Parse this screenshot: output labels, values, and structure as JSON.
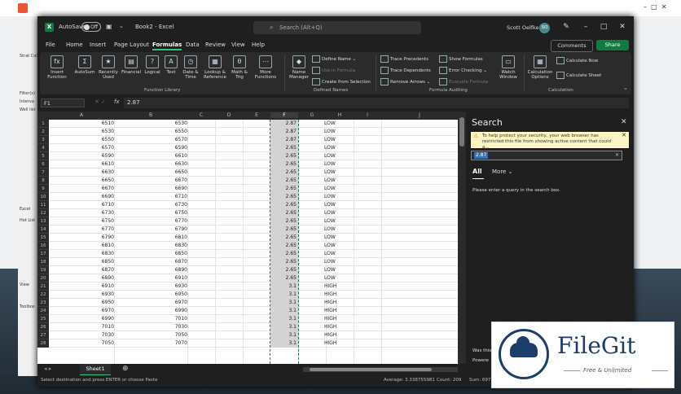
{
  "bg_app": {
    "title": "Strat Coll Manag",
    "side_labels": [
      "Filter(s)",
      "Interva",
      "Well list",
      "Excel",
      "Hot List",
      "View",
      "Toolbox"
    ]
  },
  "excel": {
    "autosave_label": "AutoSave",
    "autosave_state": "Off",
    "doc_name": "Book2 - Excel",
    "search_placeholder": "Search (Alt+Q)",
    "user_name": "Scott Oelfke",
    "user_initials": "SO",
    "tabs": [
      "File",
      "Home",
      "Insert",
      "Page Layout",
      "Formulas",
      "Data",
      "Review",
      "View",
      "Help"
    ],
    "active_tab": "Formulas",
    "comments_label": "Comments",
    "share_label": "Share",
    "ribbon": {
      "insert_function": "Insert Function",
      "autosum": "AutoSum",
      "recently_used": "Recently Used",
      "financial": "Financial",
      "logical": "Logical",
      "text": "Text",
      "date_time": "Date & Time",
      "lookup_reference": "Lookup & Reference",
      "math_trig": "Math & Trig",
      "more_functions": "More Functions",
      "group_function_library": "Function Library",
      "name_manager": "Name Manager",
      "define_name": "Define Name",
      "use_in_formula": "Use in Formula",
      "create_from_selection": "Create from Selection",
      "group_defined_names": "Defined Names",
      "trace_precedents": "Trace Precedents",
      "trace_dependents": "Trace Dependents",
      "remove_arrows": "Remove Arrows",
      "show_formulas": "Show Formulas",
      "error_checking": "Error Checking",
      "evaluate_formula": "Evaluate Formula",
      "watch_window": "Watch Window",
      "group_formula_auditing": "Formula Auditing",
      "calculation_options": "Calculation Options",
      "calculate_now": "Calculate Now",
      "calculate_sheet": "Calculate Sheet",
      "group_calculation": "Calculation"
    },
    "name_box": "F1",
    "formula_value": "2.87",
    "columns": [
      "A",
      "B",
      "C",
      "D",
      "E",
      "F",
      "G",
      "H",
      "I",
      "J"
    ],
    "rows": [
      {
        "n": "1",
        "a": "6510",
        "b": "6530",
        "f": "2.87",
        "g": "LOW"
      },
      {
        "n": "2",
        "a": "6530",
        "b": "6550",
        "f": "2.87",
        "g": "LOW"
      },
      {
        "n": "3",
        "a": "6550",
        "b": "6570",
        "f": "2.87",
        "g": "LOW"
      },
      {
        "n": "4",
        "a": "6570",
        "b": "6590",
        "f": "2.65",
        "g": "LOW"
      },
      {
        "n": "5",
        "a": "6590",
        "b": "6610",
        "f": "2.65",
        "g": "LOW"
      },
      {
        "n": "6",
        "a": "6610",
        "b": "6630",
        "f": "2.65",
        "g": "LOW"
      },
      {
        "n": "7",
        "a": "6630",
        "b": "6650",
        "f": "2.65",
        "g": "LOW"
      },
      {
        "n": "8",
        "a": "6650",
        "b": "6670",
        "f": "2.65",
        "g": "LOW"
      },
      {
        "n": "9",
        "a": "6670",
        "b": "6690",
        "f": "2.65",
        "g": "LOW"
      },
      {
        "n": "10",
        "a": "6690",
        "b": "6710",
        "f": "2.65",
        "g": "LOW"
      },
      {
        "n": "11",
        "a": "6710",
        "b": "6730",
        "f": "2.65",
        "g": "LOW"
      },
      {
        "n": "12",
        "a": "6730",
        "b": "6750",
        "f": "2.65",
        "g": "LOW"
      },
      {
        "n": "13",
        "a": "6750",
        "b": "6770",
        "f": "2.65",
        "g": "LOW"
      },
      {
        "n": "14",
        "a": "6770",
        "b": "6790",
        "f": "2.65",
        "g": "LOW"
      },
      {
        "n": "15",
        "a": "6790",
        "b": "6810",
        "f": "2.65",
        "g": "LOW"
      },
      {
        "n": "16",
        "a": "6810",
        "b": "6830",
        "f": "2.65",
        "g": "LOW"
      },
      {
        "n": "17",
        "a": "6830",
        "b": "6850",
        "f": "2.65",
        "g": "LOW"
      },
      {
        "n": "18",
        "a": "6850",
        "b": "6870",
        "f": "2.65",
        "g": "LOW"
      },
      {
        "n": "19",
        "a": "6870",
        "b": "6890",
        "f": "2.65",
        "g": "LOW"
      },
      {
        "n": "20",
        "a": "6890",
        "b": "6910",
        "f": "2.65",
        "g": "LOW"
      },
      {
        "n": "21",
        "a": "6910",
        "b": "6930",
        "f": "3.1",
        "g": "HIGH"
      },
      {
        "n": "22",
        "a": "6930",
        "b": "6950",
        "f": "3.1",
        "g": "HIGH"
      },
      {
        "n": "23",
        "a": "6950",
        "b": "6970",
        "f": "3.1",
        "g": "HIGH"
      },
      {
        "n": "24",
        "a": "6970",
        "b": "6990",
        "f": "3.1",
        "g": "HIGH"
      },
      {
        "n": "25",
        "a": "6990",
        "b": "7010",
        "f": "3.1",
        "g": "HIGH"
      },
      {
        "n": "26",
        "a": "7010",
        "b": "7030",
        "f": "3.1",
        "g": "HIGH"
      },
      {
        "n": "27",
        "a": "7030",
        "b": "7050",
        "f": "3.1",
        "g": "HIGH"
      },
      {
        "n": "28",
        "a": "7050",
        "b": "7070",
        "f": "3.1",
        "g": "HIGH"
      }
    ],
    "sheet_tab": "Sheet1",
    "status_left": "Select destination and press ENTER or choose Paste",
    "status_average": "Average: 3.338755981",
    "status_count": "Count: 209",
    "status_sum": "Sum: 697.8"
  },
  "search_pane": {
    "title": "Search",
    "security_message": "To help protect your security, your web browser has restricted this file from showing active content that could a...",
    "query": "2.87",
    "tab_all": "All",
    "tab_more": "More",
    "empty_message": "Please enter a query in the search box.",
    "footer_1": "Was this",
    "footer_2": "Powere"
  },
  "watermark": {
    "name": "FileGit",
    "tagline": "Free & Unlimited"
  },
  "colors": {
    "excel_green": "#107c41",
    "accent_green": "#33c481",
    "dark_bg": "#1f1f1f",
    "ribbon_bg": "#2b2b2b",
    "watermark_blue": "#1b3d68"
  }
}
